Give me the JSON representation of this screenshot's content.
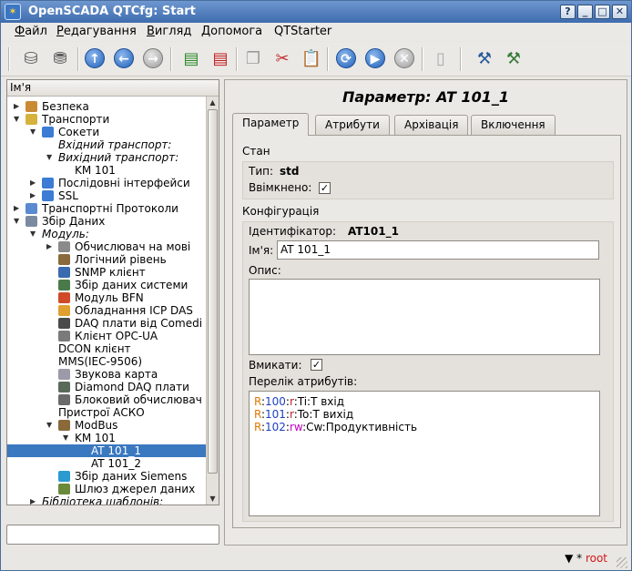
{
  "window": {
    "title": "OpenSCADA QTCfg: Start",
    "buttons": {
      "help": "?",
      "minimize": "_",
      "maximize": "□",
      "close": "✕"
    }
  },
  "menu": [
    {
      "label": "Файл",
      "mnemonic": "Ф",
      "rest": "айл"
    },
    {
      "label": "Редагування",
      "mnemonic": "Р",
      "rest": "едагування"
    },
    {
      "label": "Вигляд",
      "mnemonic": "В",
      "rest": "игляд"
    },
    {
      "label": "Допомога",
      "mnemonic": "Д",
      "rest": "опомога"
    },
    {
      "label": "QTStarter",
      "mnemonic": "",
      "rest": "QTStarter"
    }
  ],
  "toolbar": {
    "icons": [
      "db-load-icon",
      "db-save-icon",
      "up-icon",
      "back-icon",
      "forward-icon",
      "add-item-icon",
      "delete-item-icon",
      "copy-icon",
      "cut-icon",
      "paste-icon",
      "refresh-icon",
      "start-icon",
      "stop-icon",
      "book-icon",
      "qtcfg-icon",
      "uiedit-icon"
    ]
  },
  "tree": {
    "header": "Ім'я",
    "rows": [
      {
        "label": "Безпека",
        "exp": "▶",
        "level": 2,
        "icon": "#c98a34",
        "italic": false,
        "selected": false
      },
      {
        "label": "Транспорти",
        "exp": "▼",
        "level": 2,
        "icon": "#d4b23c",
        "italic": false,
        "selected": false
      },
      {
        "label": "Сокети",
        "exp": "▼",
        "level": 3,
        "icon": "#3c7cd4",
        "italic": false,
        "selected": false
      },
      {
        "label": "Вхідний транспорт:",
        "exp": "",
        "level": 4,
        "icon": "",
        "italic": true,
        "selected": false
      },
      {
        "label": "Вихідний транспорт:",
        "exp": "▼",
        "level": 4,
        "icon": "",
        "italic": true,
        "selected": false
      },
      {
        "label": "KM 101",
        "exp": "",
        "level": 5,
        "icon": "",
        "italic": false,
        "selected": false
      },
      {
        "label": "Послідовні інтерфейси",
        "exp": "▶",
        "level": 3,
        "icon": "#3c7cd4",
        "italic": false,
        "selected": false
      },
      {
        "label": "SSL",
        "exp": "▶",
        "level": 3,
        "icon": "#3c7cd4",
        "italic": false,
        "selected": false
      },
      {
        "label": "Транспортні Протоколи",
        "exp": "▶",
        "level": 2,
        "icon": "#5a8ad0",
        "italic": false,
        "selected": false
      },
      {
        "label": "Збір Даних",
        "exp": "▼",
        "level": 2,
        "icon": "#7c8aa0",
        "italic": false,
        "selected": false
      },
      {
        "label": "Модуль:",
        "exp": "▼",
        "level": 3,
        "icon": "",
        "italic": true,
        "selected": false
      },
      {
        "label": "Обчислювач на мові",
        "exp": "▶",
        "level": 4,
        "icon": "#8a8a8a",
        "italic": false,
        "selected": false
      },
      {
        "label": "Логічний рівень",
        "exp": "",
        "level": 4,
        "icon": "#8a6a3a",
        "italic": false,
        "selected": false
      },
      {
        "label": "SNMP клієнт",
        "exp": "",
        "level": 4,
        "icon": "#3a6ab0",
        "italic": false,
        "selected": false
      },
      {
        "label": "Збір даних системи",
        "exp": "",
        "level": 4,
        "icon": "#4a7a4a",
        "italic": false,
        "selected": false
      },
      {
        "label": "Модуль BFN",
        "exp": "",
        "level": 4,
        "icon": "#d04a2a",
        "italic": false,
        "selected": false
      },
      {
        "label": "Обладнання ICP DAS",
        "exp": "",
        "level": 4,
        "icon": "#e0a030",
        "italic": false,
        "selected": false
      },
      {
        "label": "DAQ плати від Comedi",
        "exp": "",
        "level": 4,
        "icon": "#4a4a4a",
        "italic": false,
        "selected": false
      },
      {
        "label": "Клієнт OPC-UA",
        "exp": "",
        "level": 4,
        "icon": "#7a7a7a",
        "italic": false,
        "selected": false
      },
      {
        "label": "DCON клієнт",
        "exp": "",
        "level": 4,
        "icon": "",
        "italic": false,
        "selected": false
      },
      {
        "label": "MMS(IEC-9506)",
        "exp": "",
        "level": 4,
        "icon": "",
        "italic": false,
        "selected": false
      },
      {
        "label": "Звукова карта",
        "exp": "",
        "level": 4,
        "icon": "#9a9aa8",
        "italic": false,
        "selected": false
      },
      {
        "label": "Diamond DAQ плати",
        "exp": "",
        "level": 4,
        "icon": "#5a6a5a",
        "italic": false,
        "selected": false
      },
      {
        "label": "Блоковий обчислювач",
        "exp": "",
        "level": 4,
        "icon": "#6a6a6a",
        "italic": false,
        "selected": false
      },
      {
        "label": "Пристрої АСКО",
        "exp": "",
        "level": 4,
        "icon": "",
        "italic": false,
        "selected": false
      },
      {
        "label": "ModBus",
        "exp": "▼",
        "level": 4,
        "icon": "#8a6a3a",
        "italic": false,
        "selected": false
      },
      {
        "label": "KM 101",
        "exp": "▼",
        "level": 5,
        "icon": "",
        "italic": false,
        "selected": false
      },
      {
        "label": "AT 101_1",
        "exp": "",
        "level": 6,
        "icon": "",
        "italic": false,
        "selected": true
      },
      {
        "label": "AT 101_2",
        "exp": "",
        "level": 6,
        "icon": "",
        "italic": false,
        "selected": false
      },
      {
        "label": "Збір даних Siemens",
        "exp": "",
        "level": 4,
        "icon": "#2a9ad0",
        "italic": false,
        "selected": false
      },
      {
        "label": "Шлюз джерел даних",
        "exp": "",
        "level": 4,
        "icon": "#6a8a3a",
        "italic": false,
        "selected": false
      },
      {
        "label": "Бібліотека шаблонів:",
        "exp": "▶",
        "level": 3,
        "icon": "",
        "italic": true,
        "selected": false
      }
    ]
  },
  "page": {
    "title": "Параметр: AT 101_1",
    "tabs": [
      "Параметр",
      "Атрибути",
      "Архівація",
      "Включення"
    ],
    "state": {
      "group_title": "Стан",
      "type_label": "Тип:",
      "type_value": "std",
      "enabled_label": "Ввімкнено:",
      "enabled_checked": "✓"
    },
    "config": {
      "group_title": "Конфігурація",
      "id_label": "Ідентифікатор:",
      "id_value": "AT101_1",
      "name_label": "Ім'я:",
      "name_value": "AT 101_1",
      "descr_label": "Опис:",
      "descr_value": "",
      "enable_label": "Вмикати:",
      "enable_checked": "✓",
      "attr_list_label": "Перелік атрибутів:",
      "attr_lines": [
        {
          "p1": "R",
          "s1": ":",
          "p2": "100",
          "s2": ":",
          "p3": "r",
          "s3": ":",
          "p4": "Ti",
          "s4": ":",
          "p5": "T вхід"
        },
        {
          "p1": "R",
          "s1": ":",
          "p2": "101",
          "s2": ":",
          "p3": "r",
          "s3": ":",
          "p4": "To",
          "s4": ":",
          "p5": "T вихід"
        },
        {
          "p1": "R",
          "s1": ":",
          "p2": "102",
          "s2": ":",
          "p3": "rw",
          "s3": ":",
          "p4": "Cw",
          "s4": ":",
          "p5": "Продуктивність"
        }
      ]
    }
  },
  "status": {
    "user_prefix": "▼ *",
    "user": "root"
  },
  "colors": {
    "selection": "#3a78c0",
    "title_bar": "#3e6cae",
    "user_text": "#d01818"
  }
}
